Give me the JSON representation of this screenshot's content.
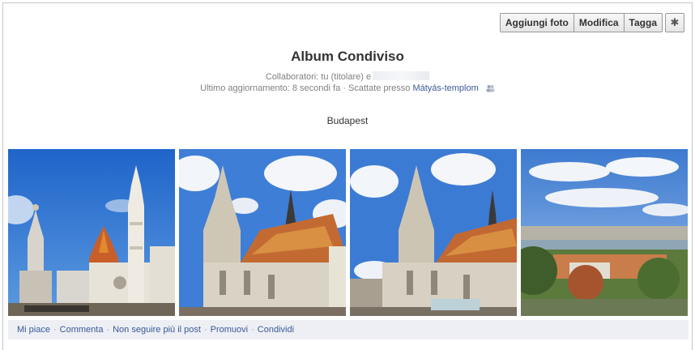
{
  "toolbar": {
    "add_photos": "Aggiungi foto",
    "edit": "Modifica",
    "tag": "Tagga",
    "settings_icon": "gear-icon"
  },
  "album": {
    "title": "Album Condiviso",
    "collaborators_prefix": "Collaboratori: tu (titolare) e",
    "updated_text": "Ultimo aggiornamento: 8 secondi fa · Scattate presso",
    "location_link": "Mátyás-templom",
    "description": "Budapest"
  },
  "photos": [
    {
      "name": "matthias-church-trinity-column"
    },
    {
      "name": "matthias-church-tower-clouds"
    },
    {
      "name": "matthias-church-tower-clouds-2"
    },
    {
      "name": "budapest-danube-panorama"
    }
  ],
  "actions": {
    "like": "Mi piace",
    "comment": "Commenta",
    "unfollow": "Non seguire più il post",
    "promote": "Promuovi",
    "share": "Condividi",
    "separator": "·"
  },
  "colors": {
    "link": "#3b5998",
    "action_bar": "#edeff4",
    "muted_text": "#808080"
  }
}
